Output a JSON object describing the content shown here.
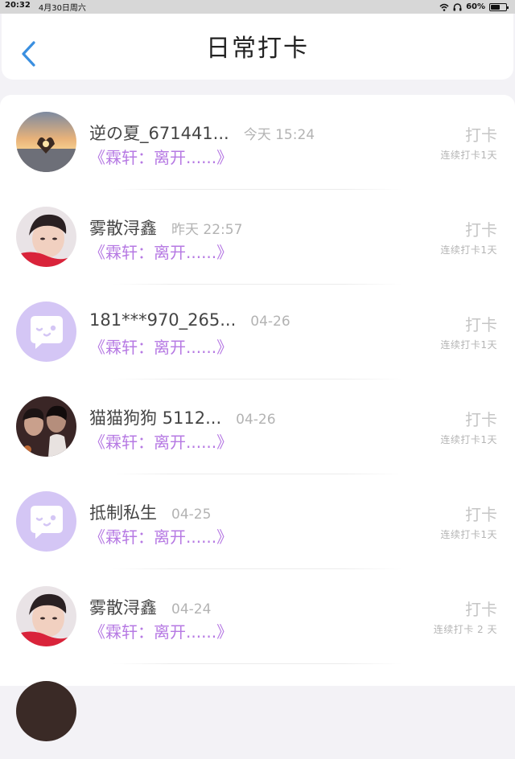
{
  "status_bar": {
    "time": "20:32",
    "date": "4月30日周六",
    "battery": "60%",
    "battery_level": 0.6
  },
  "header": {
    "title": "日常打卡",
    "accent": "#3a8fe0"
  },
  "colors": {
    "work_title": "#b679e3",
    "default_avatar_bg": "#d4c6f5"
  },
  "checkins": [
    {
      "name": "逆の夏_671441...",
      "time": "今天 15:24",
      "work": "《霖轩：离开......》",
      "action": "打卡",
      "streak": "连续打卡1天",
      "avatar": "sunset-heart-photo"
    },
    {
      "name": "雾散浔鑫",
      "time": "昨天 22:57",
      "work": "《霖轩：离开......》",
      "action": "打卡",
      "streak": "连续打卡1天",
      "avatar": "boy-portrait-photo"
    },
    {
      "name": "181***970_265...",
      "time": "04-26",
      "work": "《霖轩：离开......》",
      "action": "打卡",
      "streak": "连续打卡1天",
      "avatar": "default-chat-bubble"
    },
    {
      "name": "猫猫狗狗 5112...",
      "time": "04-26",
      "work": "《霖轩：离开......》",
      "action": "打卡",
      "streak": "连续打卡1天",
      "avatar": "couple-movie-photo"
    },
    {
      "name": "抵制私生",
      "time": "04-25",
      "work": "《霖轩：离开......》",
      "action": "打卡",
      "streak": "连续打卡1天",
      "avatar": "default-chat-bubble"
    },
    {
      "name": "雾散浔鑫",
      "time": "04-24",
      "work": "《霖轩：离开......》",
      "action": "打卡",
      "streak": "连续打卡 2 天",
      "avatar": "boy-portrait-photo"
    }
  ]
}
